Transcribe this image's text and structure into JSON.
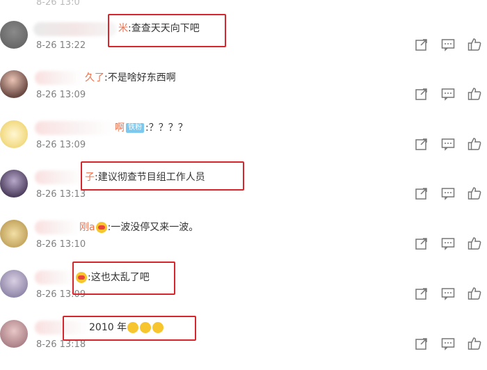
{
  "top_fragment": "8-26 13:0",
  "comments": [
    {
      "name": "米",
      "text": ":查查天天向下吧",
      "time": "8-26 13:22"
    },
    {
      "name": "久了",
      "text": ":不是啥好东西啊",
      "time": "8-26 13:09"
    },
    {
      "name": "啊",
      "badge": "铁粉",
      "text": ":？？？？",
      "time": "8-26 13:09"
    },
    {
      "name": "子",
      "text": ":建议彻查节目组工作人员",
      "time": "8-26 13:13"
    },
    {
      "name": "刚a",
      "text": ":一波没停又来一波。",
      "time": "8-26 13:10"
    },
    {
      "name": "",
      "text": ":这也太乱了吧",
      "time": "8-26 13:09"
    },
    {
      "name": "",
      "text": "2010 年",
      "time": "8-26 13:18"
    }
  ],
  "icons": {
    "share": "share-icon",
    "comment": "comment-icon",
    "like": "thumbs-up-icon"
  },
  "colors": {
    "username": "#eb7350",
    "highlight_box": "#d7262b",
    "badge": "#7cc8ef",
    "timestamp": "#808080"
  }
}
